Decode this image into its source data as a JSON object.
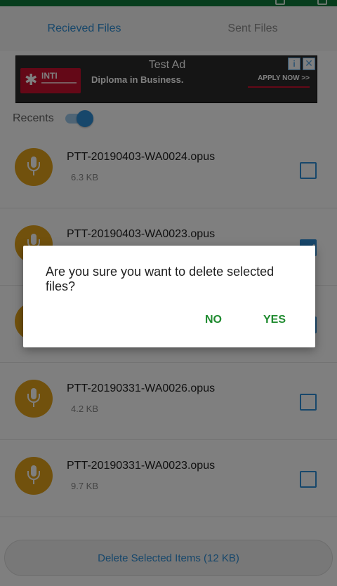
{
  "tabs": [
    {
      "label": "Recieved Files",
      "active": true
    },
    {
      "label": "Sent Files",
      "active": false
    }
  ],
  "ad": {
    "title": "Test Ad",
    "brand": "INTI",
    "text": "Diploma in Business.",
    "cta": "APPLY NOW >>",
    "info_glyph": "i",
    "close_glyph": "✕"
  },
  "recents": {
    "label": "Recents",
    "enabled": true
  },
  "files": [
    {
      "name": "PTT-20190403-WA0024.opus",
      "size": "6.3 KB",
      "checked": false
    },
    {
      "name": "PTT-20190403-WA0023.opus",
      "size": "",
      "checked": true
    },
    {
      "name": "",
      "size": "",
      "checked": true
    },
    {
      "name": "PTT-20190331-WA0026.opus",
      "size": "4.2 KB",
      "checked": false
    },
    {
      "name": "PTT-20190331-WA0023.opus",
      "size": "9.7 KB",
      "checked": false
    }
  ],
  "bottom": {
    "label": "Delete Selected Items (12 KB)"
  },
  "dialog": {
    "message": "Are you sure you want to delete selected files?",
    "no_label": "NO",
    "yes_label": "YES"
  },
  "colors": {
    "accent": "#2e8fd6",
    "status_bar": "#0f7a3a",
    "avatar": "#e3a21a",
    "dialog_button": "#1e8a2e"
  },
  "icons": {
    "file_avatar": "microphone-icon",
    "ad_logo": "inti-logo-icon"
  }
}
